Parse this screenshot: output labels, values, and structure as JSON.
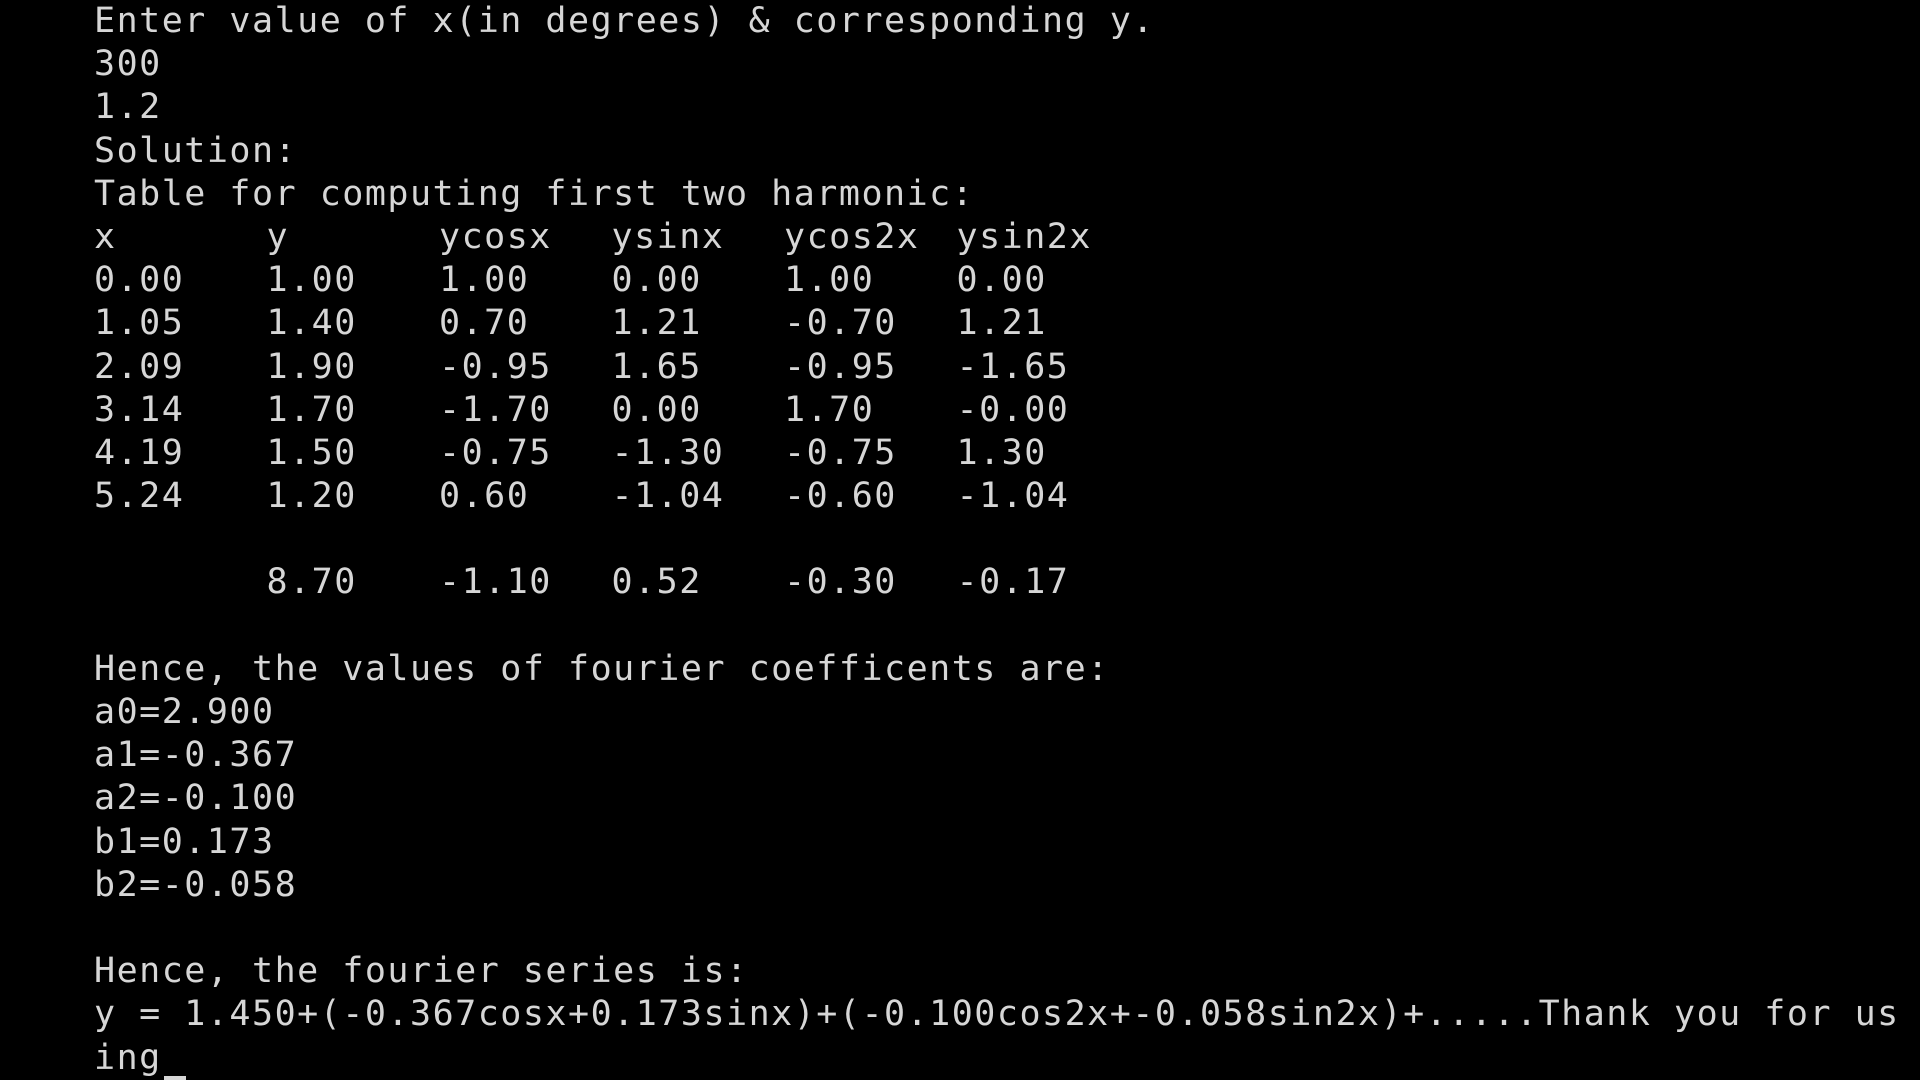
{
  "terminal": {
    "prompt": "Enter value of x(in degrees) & corresponding y.",
    "input_x": "300",
    "input_y": "1.2",
    "solution_label": "Solution:",
    "table_title": "Table for computing first two harmonic:",
    "table": {
      "headers": [
        "x",
        "y",
        "ycosx",
        "ysinx",
        "ycos2x",
        "ysin2x"
      ],
      "rows": [
        [
          "0.00",
          "1.00",
          "1.00",
          "0.00",
          "1.00",
          "0.00"
        ],
        [
          "1.05",
          "1.40",
          "0.70",
          "1.21",
          "-0.70",
          "1.21"
        ],
        [
          "2.09",
          "1.90",
          "-0.95",
          "1.65",
          "-0.95",
          "-1.65"
        ],
        [
          "3.14",
          "1.70",
          "-1.70",
          "0.00",
          "1.70",
          "-0.00"
        ],
        [
          "4.19",
          "1.50",
          "-0.75",
          "-1.30",
          "-0.75",
          "1.30"
        ],
        [
          "5.24",
          "1.20",
          "0.60",
          "-1.04",
          "-0.60",
          "-1.04"
        ]
      ],
      "totals": [
        "",
        "8.70",
        "-1.10",
        "0.52",
        "-0.30",
        "-0.17"
      ]
    },
    "coeff_title": "Hence, the values of fourier coefficents are:",
    "coefficients": [
      "a0=2.900",
      "a1=-0.367",
      "a2=-0.100",
      "b1=0.173",
      "b2=-0.058"
    ],
    "series_title": "Hence, the fourier series is:",
    "series_line1": "y = 1.450+(-0.367cosx+0.173sinx)+(-0.100cos2x+-0.058sin2x)+.....Thank you for us",
    "series_line2": "ing"
  },
  "colors": {
    "background": "#000000",
    "text": "#d6d6d6"
  }
}
